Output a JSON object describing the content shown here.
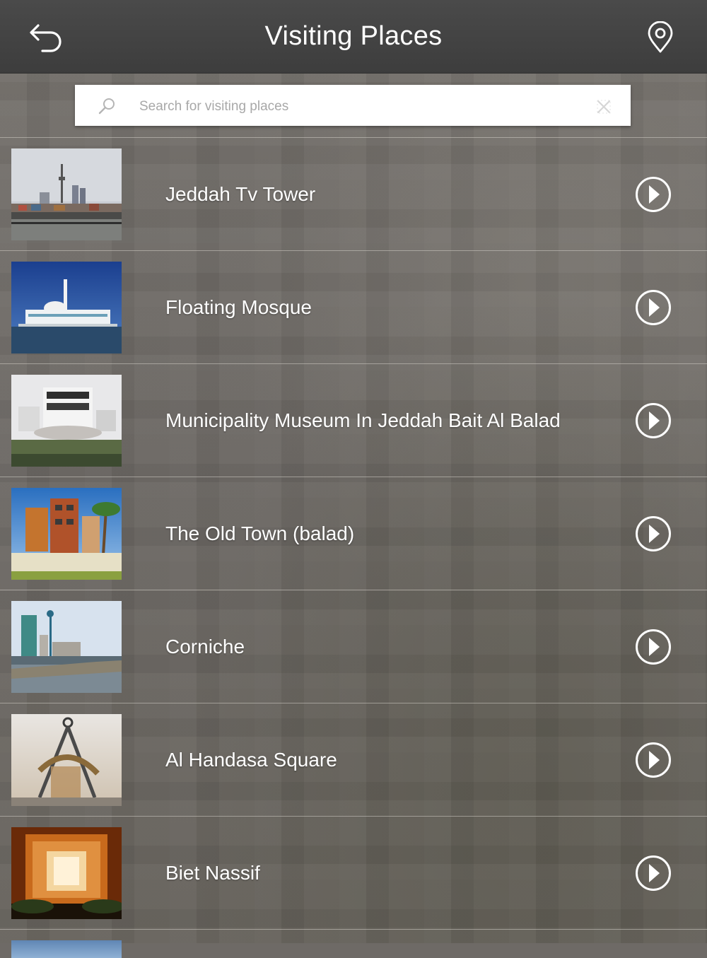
{
  "header": {
    "title": "Visiting Places",
    "back_icon": "back-arrow-icon",
    "map_icon": "map-pin-icon"
  },
  "search": {
    "placeholder": "Search for visiting places",
    "value": "",
    "search_icon": "search-icon",
    "clear_icon": "clear-icon"
  },
  "places": [
    {
      "name": "Jeddah Tv Tower",
      "image": "tv-tower-photo"
    },
    {
      "name": "Floating Mosque",
      "image": "floating-mosque-photo"
    },
    {
      "name": "Municipality Museum In Jeddah Bait Al Balad",
      "image": "museum-photo"
    },
    {
      "name": "The Old Town (balad)",
      "image": "old-town-photo"
    },
    {
      "name": "Corniche",
      "image": "corniche-photo"
    },
    {
      "name": "Al Handasa Square",
      "image": "handasa-square-photo"
    },
    {
      "name": "Biet Nassif",
      "image": "biet-nassif-photo"
    }
  ],
  "colors": {
    "header_bg": "#434343",
    "text": "#ffffff",
    "divider": "#d2cdc6"
  }
}
